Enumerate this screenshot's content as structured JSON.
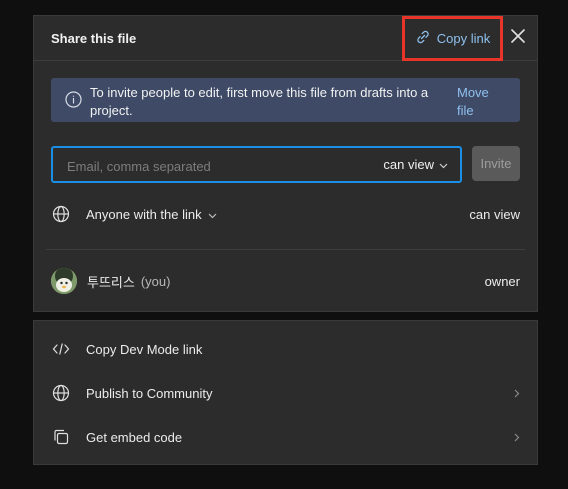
{
  "dialog": {
    "title": "Share this file",
    "copy_link_label": "Copy link"
  },
  "banner": {
    "message": "To invite people to edit, first move this file from drafts into a project.",
    "action_label": "Move file"
  },
  "invite": {
    "placeholder": "Email, comma separated",
    "value": "",
    "permission": "can view",
    "button_label": "Invite"
  },
  "access": {
    "scope_label": "Anyone with the link",
    "permission": "can view"
  },
  "members": [
    {
      "name": "투뜨리스",
      "suffix": "(you)",
      "role": "owner"
    }
  ],
  "more_options": [
    {
      "label": "Copy Dev Mode link",
      "icon": "code-icon"
    },
    {
      "label": "Publish to Community",
      "icon": "globe-icon"
    },
    {
      "label": "Get embed code",
      "icon": "copy-icon"
    }
  ],
  "colors": {
    "accent": "#1b8fe6",
    "link": "#8fc0ee",
    "highlight_box": "#e8352a",
    "banner_bg": "#3e4a66",
    "panel_bg": "#2c2c2c"
  }
}
